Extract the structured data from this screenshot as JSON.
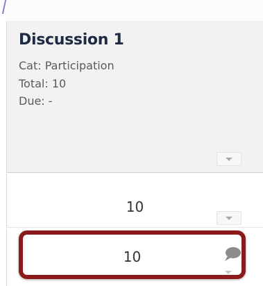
{
  "column_header": {
    "title": "Discussion 1",
    "category": "Cat: Participation",
    "total": "Total: 10",
    "due": "Due: -"
  },
  "rows": [
    {
      "score": "10"
    },
    {
      "score": "10"
    }
  ],
  "icons": {
    "header_menu": "chevron-down-icon",
    "row_menu": "chevron-down-icon",
    "comment": "comment-icon"
  },
  "colors": {
    "highlight_border": "#8b1a1a",
    "header_bg": "#f2f2f2",
    "title_text": "#1f2a44"
  }
}
